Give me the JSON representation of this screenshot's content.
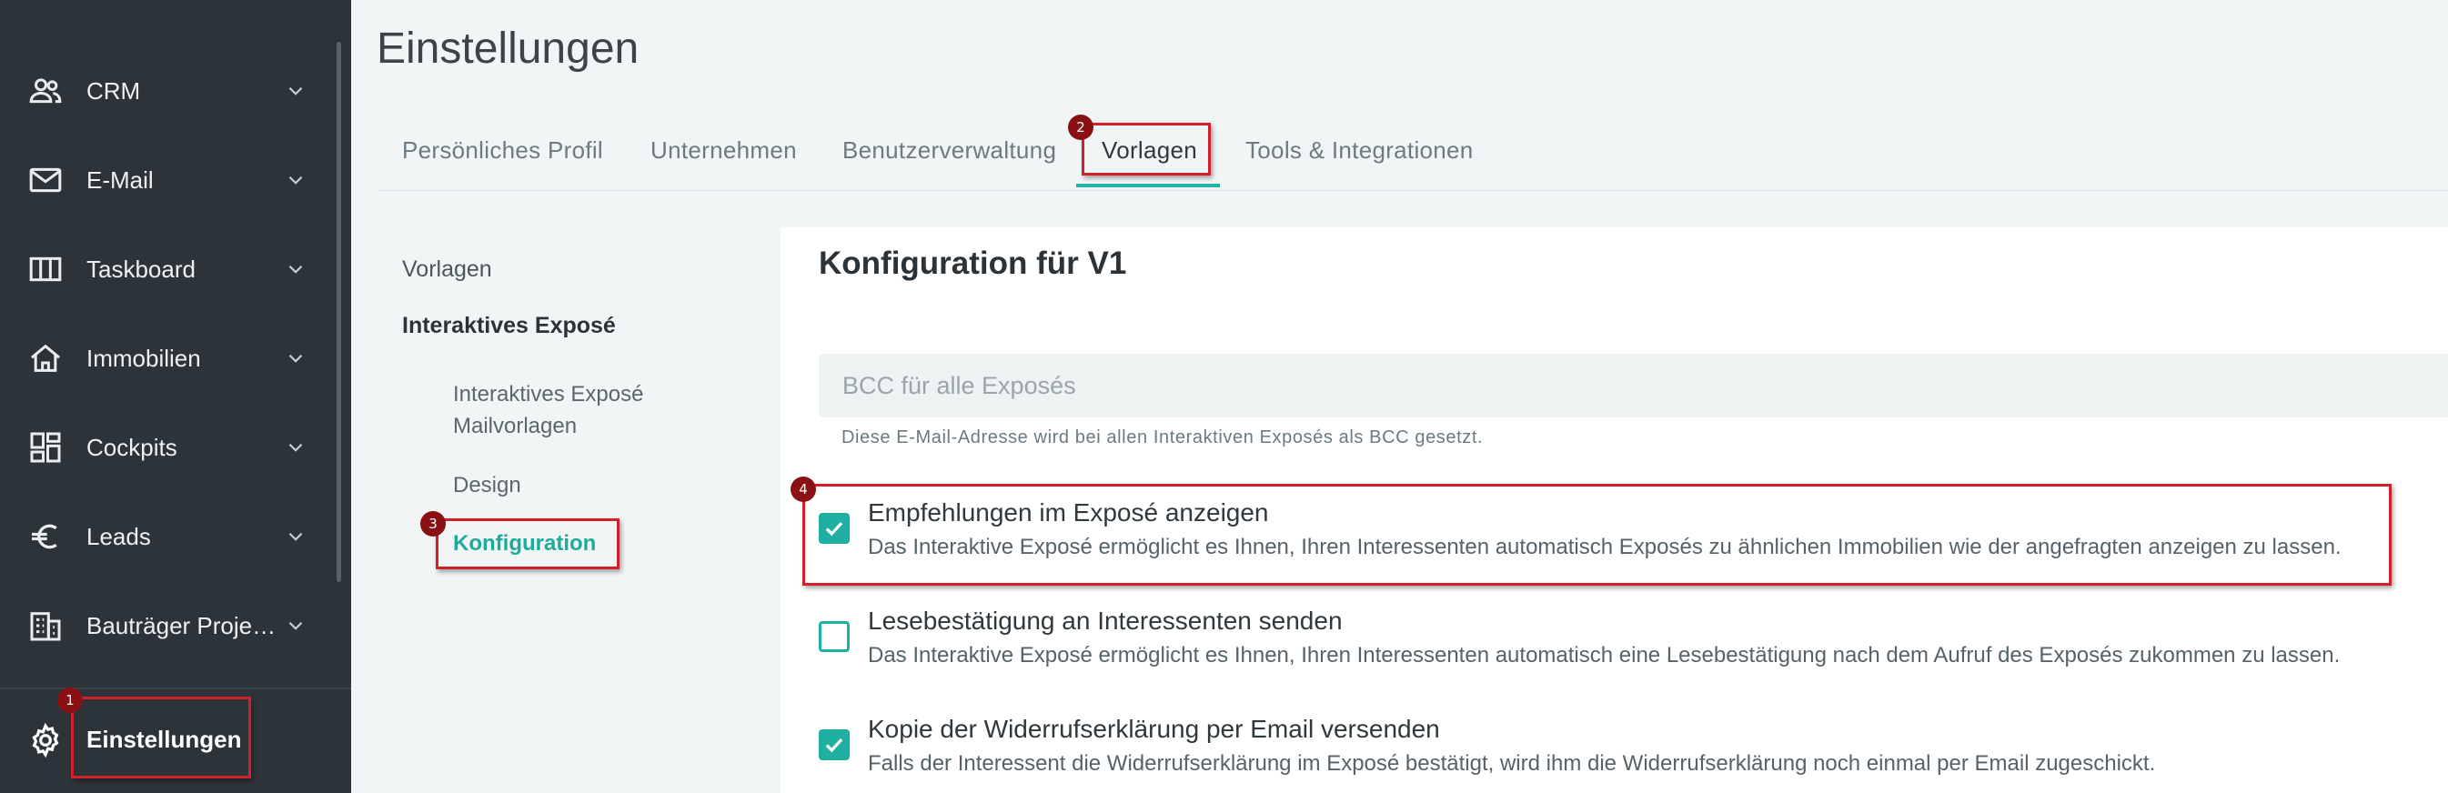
{
  "sidebar": {
    "items": [
      {
        "label": "CRM",
        "icon": "people-icon"
      },
      {
        "label": "E-Mail",
        "icon": "mail-icon"
      },
      {
        "label": "Taskboard",
        "icon": "columns-icon"
      },
      {
        "label": "Immobilien",
        "icon": "home-icon"
      },
      {
        "label": "Cockpits",
        "icon": "dashboard-icon"
      },
      {
        "label": "Leads",
        "icon": "euro-icon"
      },
      {
        "label": "Bauträger Proje…",
        "icon": "building-icon"
      }
    ],
    "settings_label": "Einstellungen"
  },
  "page": {
    "title": "Einstellungen"
  },
  "tabs": [
    {
      "label": "Persönliches Profil"
    },
    {
      "label": "Unternehmen"
    },
    {
      "label": "Benutzerverwaltung"
    },
    {
      "label": "Vorlagen",
      "active": true
    },
    {
      "label": "Tools & Integrationen"
    }
  ],
  "subnav": {
    "vorlagen": "Vorlagen",
    "group": "Interaktives Exposé",
    "children": [
      {
        "label_line1": "Interaktives Exposé",
        "label_line2": "Mailvorlagen"
      },
      {
        "label": "Design"
      },
      {
        "label": "Konfiguration",
        "active": true
      }
    ]
  },
  "config": {
    "title": "Konfiguration für V1",
    "bcc_placeholder": "BCC für alle Exposés",
    "bcc_value": "",
    "bcc_hint": "Diese E-Mail-Adresse wird bei allen Interaktiven Exposés als BCC gesetzt.",
    "options": [
      {
        "title": "Empfehlungen im Exposé anzeigen",
        "desc": "Das Interaktive Exposé ermöglicht es Ihnen, Ihren Interessenten automatisch Exposés zu ähnlichen Immobilien wie der angefragten anzeigen zu lassen.",
        "checked": true
      },
      {
        "title": "Lesebestätigung an Interessenten senden",
        "desc": "Das Interaktive Exposé ermöglicht es Ihnen, Ihren Interessenten automatisch eine Lesebestätigung nach dem Aufruf des Exposés zukommen zu lassen.",
        "checked": false
      },
      {
        "title": "Kopie der Widerrufserklärung per Email versenden",
        "desc": "Falls der Interessent die Widerrufserklärung im Exposé bestätigt, wird ihm die Widerrufserklärung noch einmal per Email zugeschickt.",
        "checked": true
      }
    ]
  },
  "annotations": [
    "1",
    "2",
    "3",
    "4"
  ],
  "colors": {
    "sidebar_bg": "#2d3439",
    "accent": "#1fb0a1",
    "highlight": "#d0202a",
    "badge": "#8b1014"
  }
}
